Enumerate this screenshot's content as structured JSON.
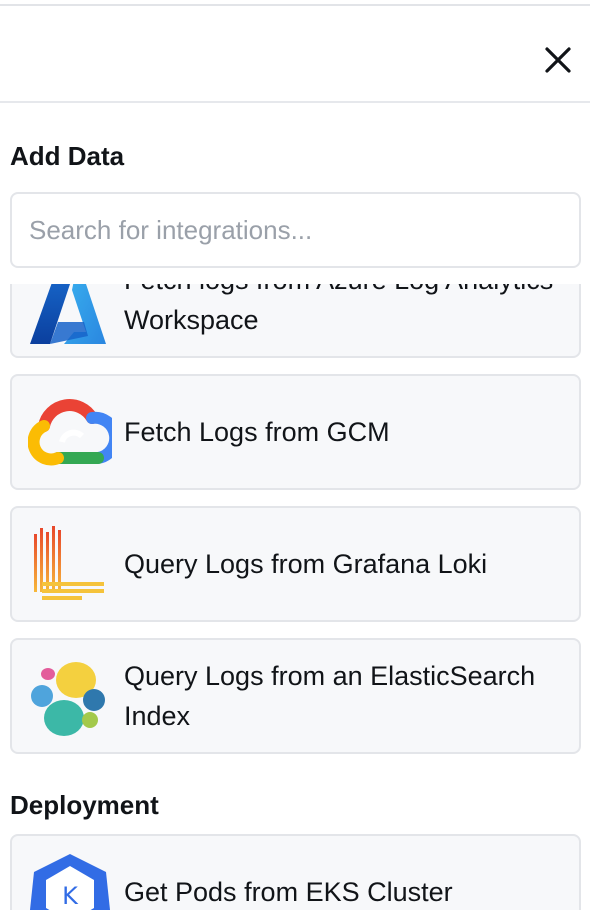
{
  "panel": {
    "add_data_title": "Add Data",
    "deployment_title": "Deployment"
  },
  "search": {
    "placeholder": "Search for integrations..."
  },
  "integrations": [
    {
      "label": "Fetch logs from Azure Log Analytics Workspace",
      "icon": "azure-icon"
    },
    {
      "label": "Fetch Logs from GCM",
      "icon": "google-cloud-icon"
    },
    {
      "label": "Query Logs from Grafana Loki",
      "icon": "grafana-loki-icon"
    },
    {
      "label": "Query Logs from an ElasticSearch Index",
      "icon": "elasticsearch-icon"
    }
  ],
  "deployment": [
    {
      "label": "Get Pods from EKS Cluster",
      "icon": "kubernetes-icon"
    }
  ],
  "colors": {
    "card_bg": "#f7f8fa",
    "card_border": "#e3e5e9",
    "text": "#111418",
    "placeholder": "#9aa0a9"
  }
}
